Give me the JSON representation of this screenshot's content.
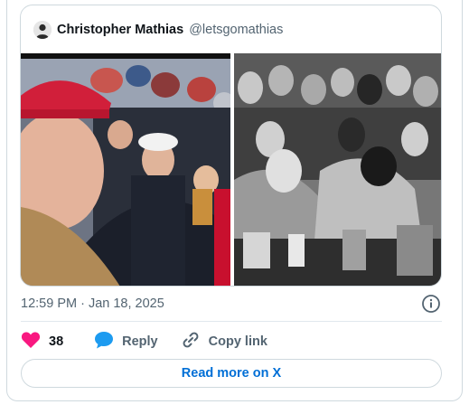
{
  "quoted_tweet": {
    "author_name": "Christopher Mathias",
    "author_handle": "@letsgomathias"
  },
  "tweet": {
    "timestamp": "12:59 PM · Jan 18, 2025"
  },
  "actions": {
    "like_count": "38",
    "reply_label": "Reply",
    "copy_link_label": "Copy link"
  },
  "read_more_label": "Read more on X",
  "icons": {
    "like": "heart-icon",
    "reply": "speech-bubble-icon",
    "copy": "link-icon",
    "info": "info-icon"
  },
  "colors": {
    "like": "#f91880",
    "reply": "#1d9bf0",
    "link_text": "#006fd6",
    "secondary_text": "#536471",
    "border": "#cfd9de"
  }
}
